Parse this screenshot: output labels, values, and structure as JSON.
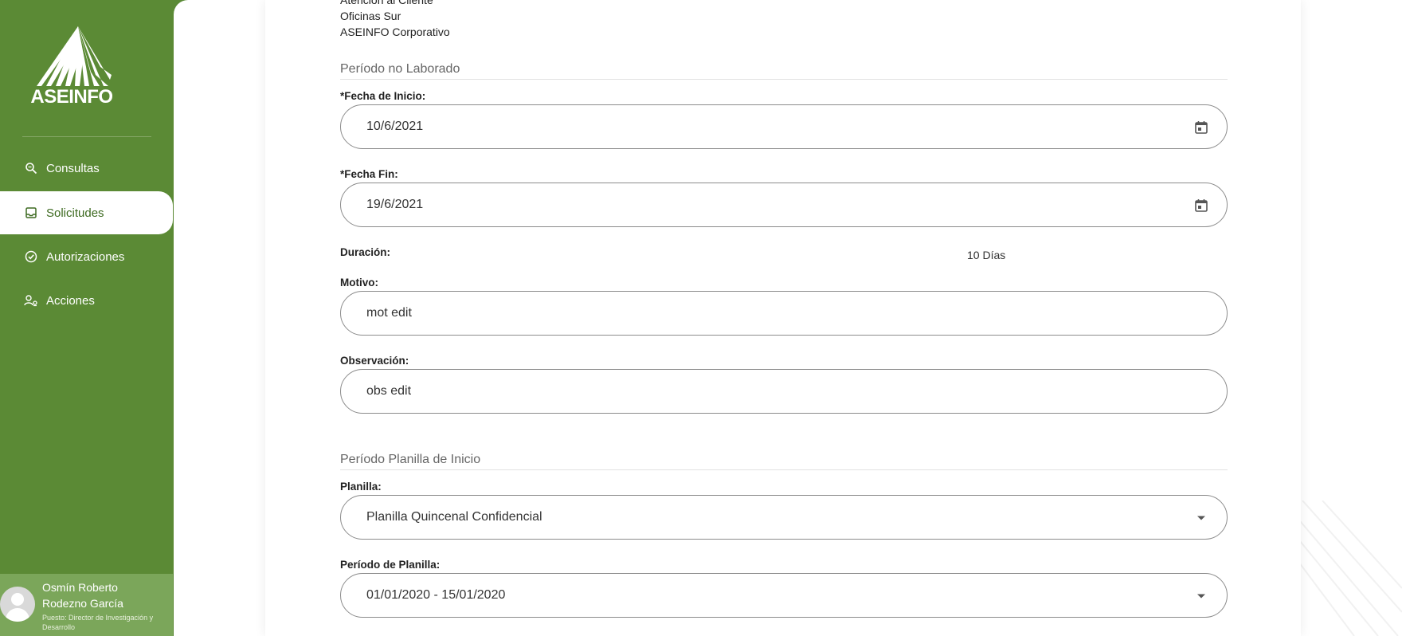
{
  "sidebar": {
    "logo_text": "ASEINFO",
    "items": [
      {
        "label": "Consultas",
        "icon": "search-icon"
      },
      {
        "label": "Solicitudes",
        "icon": "inbox-icon"
      },
      {
        "label": "Autorizaciones",
        "icon": "check-circle-icon"
      },
      {
        "label": "Acciones",
        "icon": "person-gear-icon"
      }
    ],
    "active_item": "Solicitudes",
    "user": {
      "name": "Osmín Roberto Rodezno García",
      "role": "Puesto: Director de Investigación y Desarrollo"
    }
  },
  "form": {
    "locations": [
      "Atención al Cliente",
      "Oficinas Sur",
      "ASEINFO Corporativo"
    ],
    "section_periodo": "Período no Laborado",
    "fecha_inicio_label": "*Fecha de Inicio:",
    "fecha_inicio_value": "10/6/2021",
    "fecha_fin_label": "*Fecha Fin:",
    "fecha_fin_value": "19/6/2021",
    "duracion_label": "Duración:",
    "duracion_value": "10 Días",
    "motivo_label": "Motivo:",
    "motivo_value": "mot edit",
    "observacion_label": "Observación:",
    "observacion_value": "obs edit",
    "section_planilla": "Período Planilla de Inicio",
    "planilla_label": "Planilla:",
    "planilla_value": "Planilla Quincenal Confidencial",
    "periodo_planilla_label": "Período de Planilla:",
    "periodo_planilla_value": "01/01/2020 - 15/01/2020"
  },
  "colors": {
    "sidebar_green": "#5b8a35",
    "user_box_green": "#7ba65a",
    "field_border": "#8c8c8c"
  }
}
